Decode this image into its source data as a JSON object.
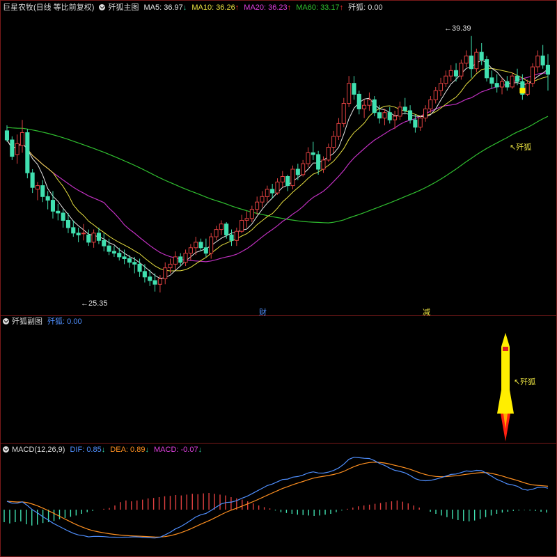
{
  "main_panel": {
    "stock_name": "巨星农牧(日线 等比前复权)",
    "indicator_name": "歼狐主图",
    "ma": [
      {
        "label": "MA5: 36.97",
        "arrow": "↓",
        "color": "#e8e8e8"
      },
      {
        "label": "MA10: 36.26",
        "arrow": "↑",
        "color": "#e8e040"
      },
      {
        "label": "MA20: 36.23",
        "arrow": "↑",
        "color": "#e040e0"
      },
      {
        "label": "MA60: 33.17",
        "arrow": "↑",
        "color": "#30c030"
      }
    ],
    "signal_label": "歼狐: 0.00",
    "high_label": "39.39",
    "low_label": "25.35",
    "annotation": "歼狐",
    "event_markers": [
      "财",
      "减"
    ]
  },
  "sub_panel": {
    "title": "歼狐副图",
    "value_label": "歼狐: 0.00",
    "annotation": "歼狐"
  },
  "macd_panel": {
    "title": "MACD(12,26,9)",
    "dif_label": "DIF: 0.85",
    "dif_arrow": "↓",
    "dea_label": "DEA: 0.89",
    "dea_arrow": "↓",
    "macd_label": "MACD: -0.07",
    "macd_arrow": "↓"
  },
  "colors": {
    "up": "#e04040",
    "down": "#40e0b0",
    "ma5": "#e8e8e8",
    "ma10": "#e8e040",
    "ma20": "#c030c0",
    "ma60": "#30c030",
    "dif": "#5090ff",
    "dea": "#ff9020",
    "rocket": "#ffee00"
  },
  "chart_data": {
    "type": "candlestick",
    "price_range": [
      24.4,
      40.6
    ],
    "candles": [
      [
        34.2,
        34.5,
        33.6,
        33.7
      ],
      [
        33.7,
        33.9,
        32.6,
        32.8
      ],
      [
        32.9,
        34.0,
        32.4,
        33.5
      ],
      [
        33.4,
        34.8,
        33.0,
        34.1
      ],
      [
        34.1,
        34.3,
        31.6,
        31.9
      ],
      [
        31.9,
        32.1,
        30.8,
        31.1
      ],
      [
        31.0,
        31.4,
        30.4,
        31.2
      ],
      [
        31.2,
        31.5,
        30.3,
        30.6
      ],
      [
        30.6,
        30.9,
        29.9,
        30.4
      ],
      [
        30.4,
        30.9,
        29.4,
        29.8
      ],
      [
        29.8,
        30.2,
        29.3,
        29.7
      ],
      [
        29.7,
        29.9,
        28.9,
        29.3
      ],
      [
        29.3,
        29.7,
        28.6,
        28.9
      ],
      [
        28.9,
        29.3,
        28.4,
        28.6
      ],
      [
        28.6,
        28.9,
        28.1,
        28.5
      ],
      [
        28.6,
        29.1,
        28.2,
        28.6
      ],
      [
        28.5,
        28.8,
        27.9,
        28.1
      ],
      [
        28.1,
        28.8,
        27.8,
        28.6
      ],
      [
        28.6,
        28.9,
        28.0,
        28.2
      ],
      [
        28.2,
        28.6,
        27.6,
        27.9
      ],
      [
        27.9,
        28.3,
        27.4,
        27.6
      ],
      [
        27.6,
        27.9,
        27.3,
        27.5
      ],
      [
        27.5,
        27.8,
        27.1,
        27.3
      ],
      [
        27.3,
        27.7,
        26.9,
        27.2
      ],
      [
        27.2,
        27.4,
        26.7,
        27.0
      ],
      [
        27.0,
        27.3,
        26.4,
        26.9
      ],
      [
        26.9,
        27.2,
        26.2,
        26.5
      ],
      [
        26.5,
        26.9,
        25.9,
        26.2
      ],
      [
        26.2,
        26.6,
        25.7,
        26.0
      ],
      [
        26.0,
        26.4,
        25.4,
        25.8
      ],
      [
        25.8,
        26.3,
        25.35,
        26.1
      ],
      [
        26.1,
        27.0,
        25.8,
        26.7
      ],
      [
        26.7,
        27.2,
        26.4,
        26.9
      ],
      [
        26.9,
        27.6,
        26.6,
        27.3
      ],
      [
        27.3,
        27.5,
        26.8,
        27.0
      ],
      [
        27.0,
        27.7,
        26.8,
        27.5
      ],
      [
        27.5,
        28.0,
        27.1,
        27.8
      ],
      [
        27.8,
        28.4,
        27.4,
        28.1
      ],
      [
        28.1,
        28.3,
        27.6,
        27.8
      ],
      [
        27.8,
        28.3,
        27.3,
        27.5
      ],
      [
        27.5,
        28.6,
        27.2,
        28.4
      ],
      [
        28.4,
        29.0,
        28.2,
        28.8
      ],
      [
        28.8,
        29.3,
        28.5,
        29.1
      ],
      [
        29.1,
        29.2,
        28.3,
        28.5
      ],
      [
        28.5,
        28.8,
        27.9,
        28.2
      ],
      [
        28.2,
        28.9,
        27.9,
        28.7
      ],
      [
        28.7,
        29.6,
        28.6,
        29.3
      ],
      [
        29.3,
        29.8,
        28.9,
        29.4
      ],
      [
        29.4,
        30.1,
        29.2,
        29.9
      ],
      [
        29.9,
        30.6,
        29.6,
        30.3
      ],
      [
        30.3,
        30.9,
        30.0,
        30.6
      ],
      [
        30.6,
        31.2,
        30.3,
        31.0
      ],
      [
        31.0,
        31.3,
        30.5,
        30.8
      ],
      [
        30.8,
        31.6,
        30.7,
        31.4
      ],
      [
        31.4,
        32.0,
        31.1,
        31.7
      ],
      [
        31.7,
        31.8,
        30.9,
        31.2
      ],
      [
        31.2,
        32.3,
        31.0,
        32.1
      ],
      [
        32.1,
        32.4,
        31.5,
        31.8
      ],
      [
        31.8,
        32.6,
        31.7,
        32.4
      ],
      [
        32.4,
        33.3,
        32.2,
        33.0
      ],
      [
        33.0,
        33.6,
        32.6,
        32.9
      ],
      [
        32.9,
        33.1,
        31.8,
        32.1
      ],
      [
        32.1,
        32.8,
        31.9,
        32.6
      ],
      [
        32.6,
        33.5,
        32.5,
        33.3
      ],
      [
        33.3,
        34.2,
        33.0,
        33.9
      ],
      [
        33.9,
        34.9,
        33.7,
        34.6
      ],
      [
        34.6,
        36.0,
        34.4,
        35.7
      ],
      [
        35.7,
        37.2,
        35.5,
        36.8
      ],
      [
        36.8,
        37.2,
        35.9,
        36.2
      ],
      [
        36.2,
        36.4,
        35.1,
        35.4
      ],
      [
        35.4,
        35.9,
        34.9,
        35.6
      ],
      [
        35.6,
        36.3,
        35.3,
        35.9
      ],
      [
        35.9,
        36.1,
        35.0,
        35.2
      ],
      [
        35.2,
        35.6,
        34.6,
        34.9
      ],
      [
        34.9,
        35.4,
        34.5,
        35.2
      ],
      [
        35.2,
        35.5,
        34.6,
        34.8
      ],
      [
        34.8,
        35.3,
        34.3,
        35.0
      ],
      [
        35.0,
        35.8,
        34.8,
        35.5
      ],
      [
        35.5,
        36.0,
        35.1,
        35.3
      ],
      [
        35.3,
        35.6,
        34.6,
        34.8
      ],
      [
        34.8,
        35.1,
        34.1,
        34.4
      ],
      [
        34.4,
        35.0,
        34.2,
        34.9
      ],
      [
        34.9,
        35.6,
        34.7,
        35.4
      ],
      [
        35.4,
        36.1,
        35.2,
        35.9
      ],
      [
        35.9,
        36.6,
        35.7,
        36.4
      ],
      [
        36.4,
        37.1,
        36.1,
        36.8
      ],
      [
        36.8,
        37.5,
        36.6,
        37.2
      ],
      [
        37.2,
        37.8,
        36.9,
        37.5
      ],
      [
        37.5,
        37.9,
        36.9,
        37.2
      ],
      [
        37.2,
        38.1,
        37.0,
        37.9
      ],
      [
        37.9,
        38.6,
        37.7,
        38.3
      ],
      [
        38.3,
        39.39,
        37.1,
        37.6
      ],
      [
        37.6,
        38.7,
        37.4,
        38.5
      ],
      [
        38.5,
        39.0,
        37.8,
        38.1
      ],
      [
        38.1,
        38.3,
        36.9,
        37.1
      ],
      [
        37.1,
        37.5,
        36.5,
        36.8
      ],
      [
        36.8,
        37.3,
        36.3,
        36.6
      ],
      [
        36.6,
        37.1,
        36.2,
        36.9
      ],
      [
        36.9,
        37.2,
        36.4,
        36.6
      ],
      [
        36.6,
        37.4,
        36.5,
        37.2
      ],
      [
        37.2,
        37.6,
        36.7,
        36.9
      ],
      [
        36.9,
        37.3,
        35.9,
        36.2
      ],
      [
        36.2,
        37.0,
        36.1,
        36.8
      ],
      [
        36.8,
        37.9,
        36.6,
        37.7
      ],
      [
        37.7,
        38.6,
        37.4,
        38.3
      ],
      [
        38.3,
        38.9,
        37.6,
        37.8
      ],
      [
        37.8,
        38.4,
        36.4,
        37.3
      ]
    ],
    "macd_hist": [
      -0.3,
      -0.33,
      -0.3,
      -0.28,
      -0.35,
      -0.38,
      -0.36,
      -0.32,
      -0.3,
      -0.27,
      -0.23,
      -0.2,
      -0.17,
      -0.14,
      -0.1,
      -0.06,
      -0.03,
      0.0,
      0.02,
      0.04,
      0.1,
      0.18,
      0.22,
      0.2,
      0.22,
      0.24,
      0.27,
      0.28,
      0.3,
      0.32,
      0.33,
      0.35,
      0.34,
      0.36,
      0.38,
      0.37,
      0.39,
      0.4,
      0.38,
      0.36,
      0.34,
      0.3,
      0.27,
      0.24,
      0.2,
      0.15,
      0.1,
      0.06,
      0.03,
      -0.02,
      -0.06,
      -0.08,
      -0.1,
      -0.12,
      -0.13,
      -0.14,
      -0.15,
      -0.14,
      -0.12,
      -0.1,
      -0.06,
      -0.02,
      0.02,
      0.05,
      0.08,
      0.1,
      0.12,
      0.14,
      0.16,
      0.18,
      0.2,
      0.22,
      0.19,
      0.15,
      0.1,
      0.05,
      0.0,
      -0.05,
      -0.1,
      -0.14,
      -0.18,
      -0.22,
      -0.25,
      -0.27,
      -0.28,
      -0.26,
      -0.22,
      -0.18,
      -0.14,
      -0.1,
      -0.07,
      -0.05,
      -0.03,
      -0.02,
      -0.01,
      -0.02,
      -0.03,
      -0.05,
      -0.07
    ]
  }
}
